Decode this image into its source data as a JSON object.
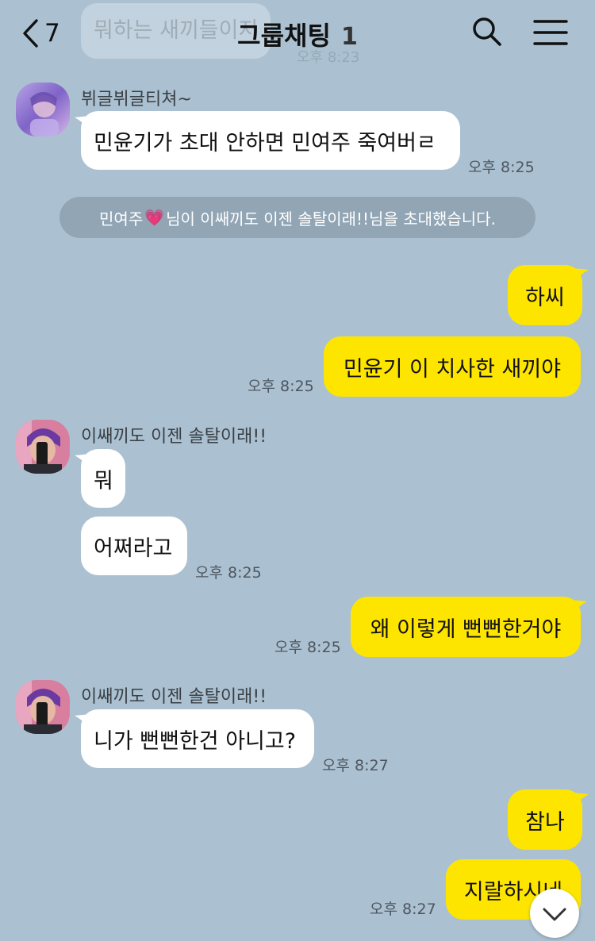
{
  "header": {
    "back_count": "7",
    "title": "그룹채팅",
    "member_count": "1"
  },
  "previous_message": {
    "text": "뭐하는 새끼들이지",
    "time": "오후 8:23"
  },
  "messages": [
    {
      "sender": "뷔글뷔글티쳐~",
      "text": "민윤기가 초대 안하면 민여주 죽여버ㄹ",
      "time": "오후 8:25"
    },
    {
      "text": "하씨"
    },
    {
      "text": "민윤기 이 치사한 새끼야",
      "time": "오후 8:25"
    },
    {
      "sender": "이쌔끼도 이젠 솔탈이래!!",
      "text": "뭐"
    },
    {
      "text": "어쩌라고",
      "time": "오후 8:25"
    },
    {
      "text": "왜 이렇게 뻔뻔한거야",
      "time": "오후 8:25"
    },
    {
      "sender": "이쌔끼도 이젠 솔탈이래!!",
      "text": "니가 뻔뻔한건 아니고?",
      "time": "오후 8:27"
    },
    {
      "text": "참나"
    },
    {
      "text": "지랄하시네",
      "time": "오후 8:27"
    }
  ],
  "system_notice": {
    "inviter": "민여주",
    "heart": "💗",
    "middle": "님이 이쌔끼도 이젠 솔탈이래!!님을 초대했습니다."
  },
  "colors": {
    "background": "#abc1d1",
    "my_bubble": "#fee500",
    "their_bubble": "#ffffff"
  },
  "icons": [
    "back-chevron-icon",
    "search-icon",
    "menu-icon",
    "chevron-down-icon"
  ]
}
